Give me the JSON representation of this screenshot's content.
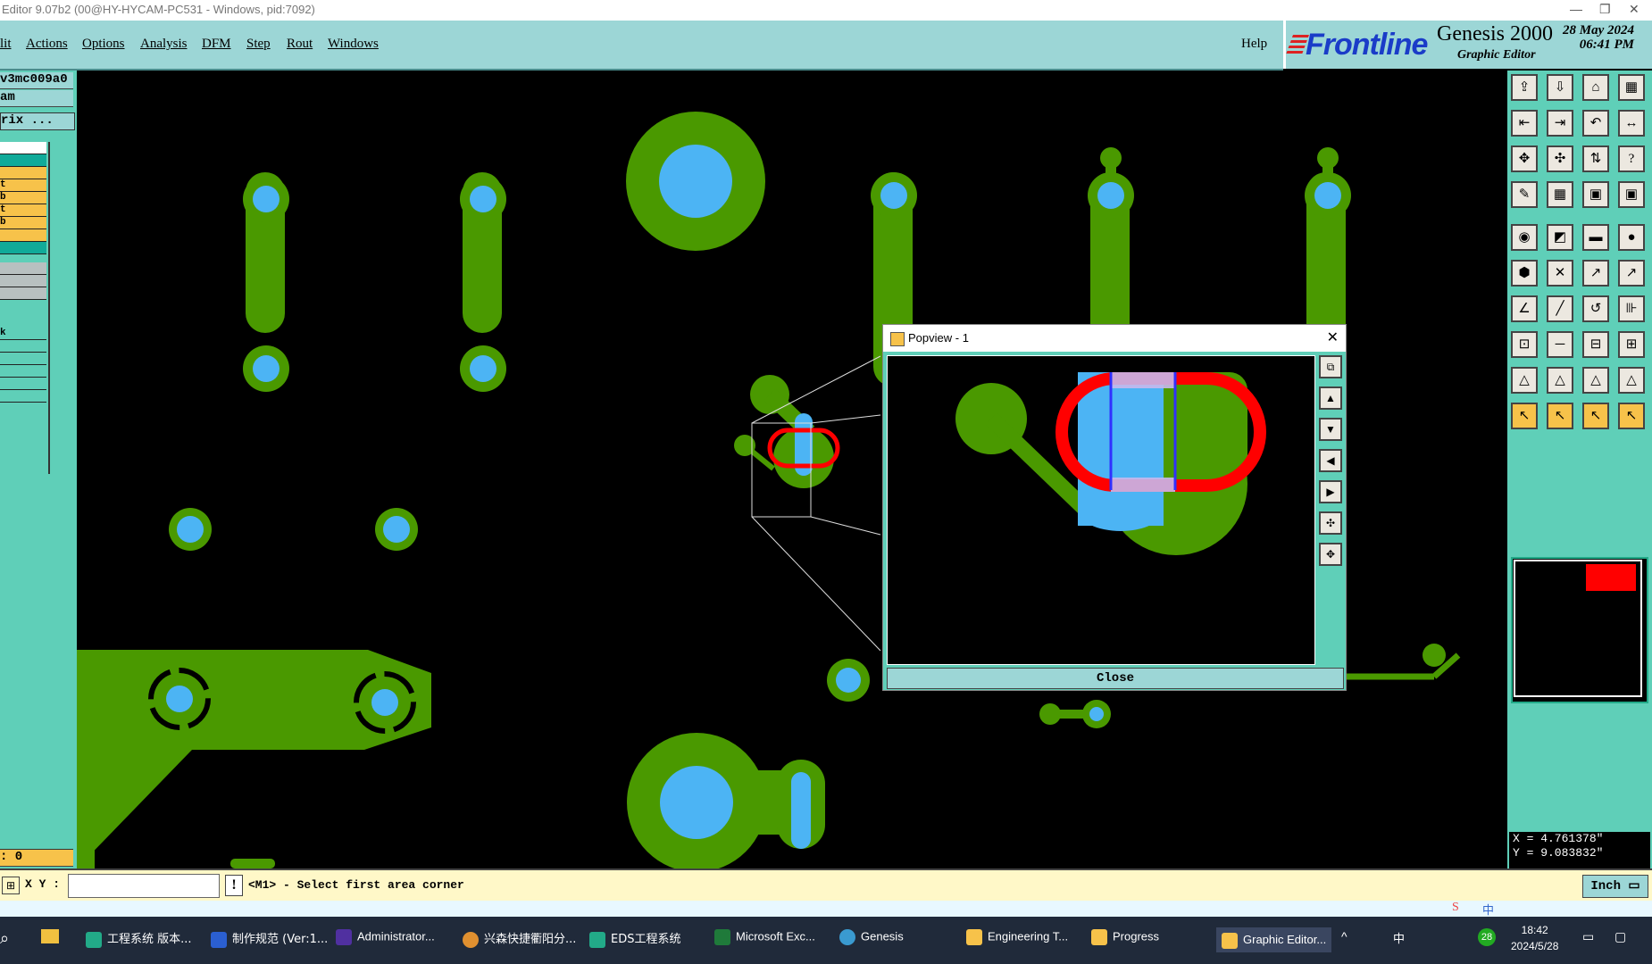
{
  "window": {
    "title": "Editor 9.07b2 (00@HY-HYCAM-PC531 - Windows, pid:7092)"
  },
  "menu": {
    "items": [
      "lit",
      "Actions",
      "Options",
      "Analysis",
      "DFM",
      "Step",
      "Rout",
      "Windows"
    ],
    "help": "Help"
  },
  "brand": {
    "logo": "Frontline",
    "product": "Genesis 2000",
    "subtitle": "Graphic Editor",
    "date": "28 May 2024",
    "time": "06:41 PM"
  },
  "left_panel": {
    "job": "v3mc009a0",
    "step": "am",
    "matrix_button": "rix ...",
    "rows": [
      "t",
      "b",
      "t",
      "b",
      "k"
    ],
    "counter": ": 0"
  },
  "popview": {
    "title": "Popview - 1",
    "close_label": "Close"
  },
  "status": {
    "xy_label": "X Y :",
    "xy_value": "",
    "prompt": "<M1> - Select first area corner",
    "unit": "Inch"
  },
  "coords": {
    "x": "X = 4.761378\"",
    "y": "Y = 9.083832\""
  },
  "colors": {
    "pad_green": "#4a9900",
    "hole_blue": "#4cb4f4",
    "highlight_red": "#ff0000",
    "panel_teal": "#5fcfb8",
    "menu_teal": "#9cd6d6"
  },
  "taskbar": {
    "items": [
      "工程系统 版本...",
      "制作规范 (Ver:1...",
      "Administrator...",
      "兴森快捷衢阳分...",
      "EDS工程系统",
      "Microsoft Exc...",
      "Genesis",
      "Engineering T...",
      "Progress",
      "Graphic Editor..."
    ],
    "clock_time": "18:42",
    "clock_date": "2024/5/28",
    "ime": "中",
    "badge": "28"
  }
}
